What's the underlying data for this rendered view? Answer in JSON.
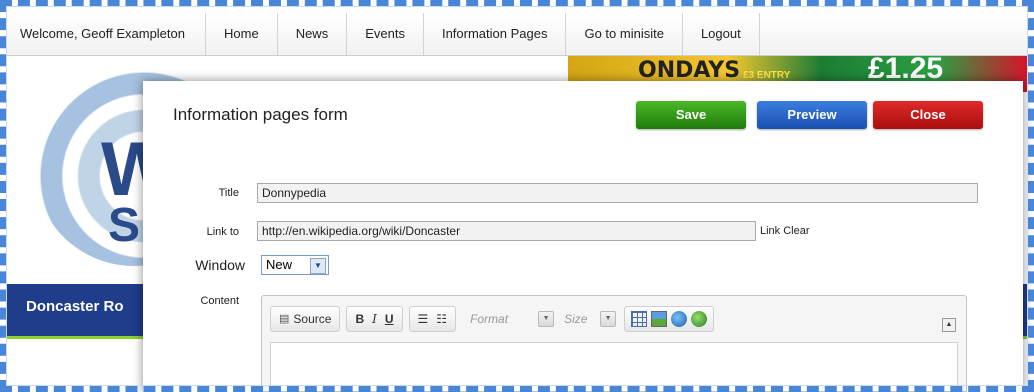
{
  "topnav": {
    "welcome": "Welcome, Geoff Exampleton",
    "items": [
      "Home",
      "News",
      "Events",
      "Information Pages",
      "Go to minisite",
      "Logout"
    ]
  },
  "background": {
    "logo_top": "W",
    "logo_bottom": "SH",
    "banner_mondays": "ONDAYS",
    "banner_entry": "£3 ENTRY",
    "banner_price": "£1.25",
    "strip_text": "Doncaster Ro"
  },
  "modal": {
    "title": "Information pages form",
    "buttons": {
      "save": "Save",
      "preview": "Preview",
      "close": "Close"
    },
    "fields": {
      "title_label": "Title",
      "title_value": "Donnypedia",
      "link_label": "Link to",
      "link_value": "http://en.wikipedia.org/wiki/Doncaster",
      "link_clear": "Link Clear",
      "window_label": "Window",
      "window_value": "New",
      "content_label": "Content"
    },
    "editor": {
      "source_label": "Source",
      "bold": "B",
      "italic": "I",
      "underline": "U",
      "format_placeholder": "Format",
      "size_placeholder": "Size"
    }
  },
  "colors": {
    "frame": "#4a86d8",
    "save": "#2e9a18",
    "preview": "#2a63c8",
    "close": "#c41a1a",
    "strip": "#1f3d8a"
  }
}
